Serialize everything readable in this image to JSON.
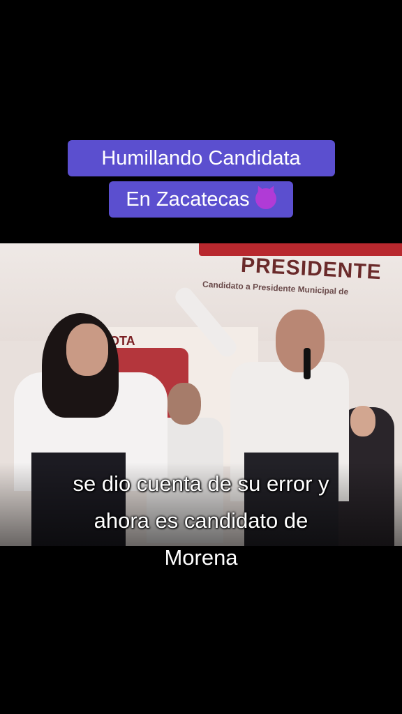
{
  "overlay": {
    "title_line1": "Humillando Candidata",
    "title_line2": "En Zacatecas",
    "emoji": "smiling-face-with-horns",
    "accent_color": "#5b4fcf"
  },
  "video": {
    "banner_text": "PRESIDENTE",
    "banner_subtext": "Candidato a Presidente Municipal de",
    "sign_text": "VOTA",
    "subtitle_lines": [
      "se dio cuenta de su error y",
      "ahora es candidato de",
      "Morena"
    ]
  }
}
